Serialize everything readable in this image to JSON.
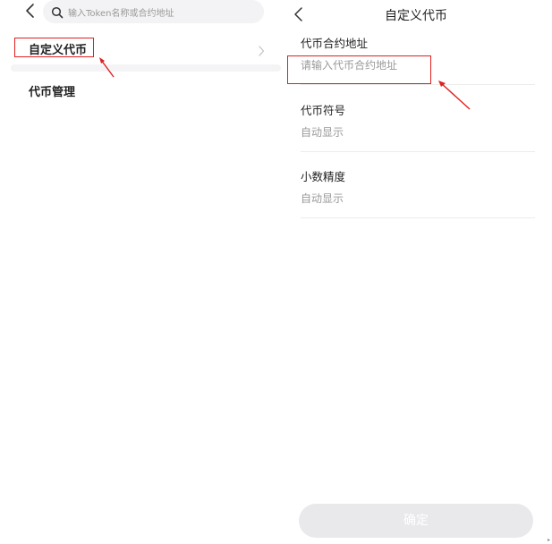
{
  "left_screen": {
    "search": {
      "placeholder": "输入Token名称或合约地址"
    },
    "menu": {
      "custom_token": "自定义代币",
      "token_manage": "代币管理"
    }
  },
  "right_screen": {
    "title": "自定义代币",
    "fields": [
      {
        "label": "代币合约地址",
        "placeholder": "请输入代币合约地址"
      },
      {
        "label": "代币符号",
        "value": "自动显示"
      },
      {
        "label": "小数精度",
        "value": "自动显示"
      }
    ],
    "confirm_label": "确定"
  },
  "colors": {
    "annotation_red": "#e02020",
    "disabled_button": "#e9e9ec",
    "search_bg": "#f3f3f5"
  },
  "icons": {
    "back": "chevron-left-icon",
    "search": "search-icon",
    "row_chevron": "chevron-right-icon"
  }
}
